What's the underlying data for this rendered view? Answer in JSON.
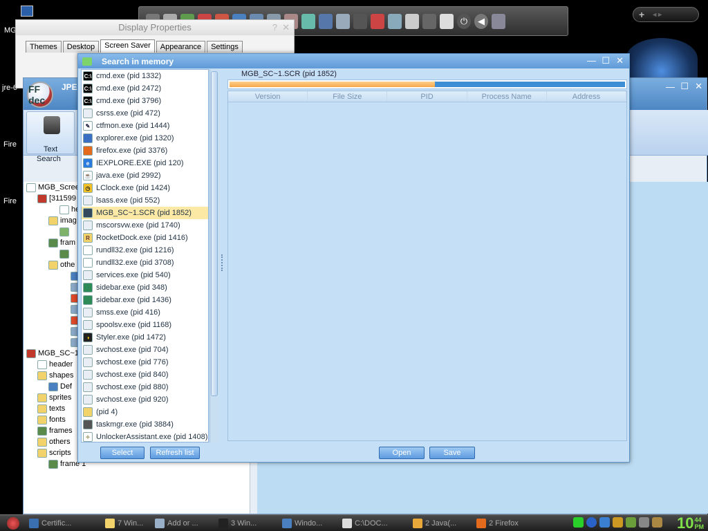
{
  "desktop": {
    "icons": [
      {
        "label": "MG"
      },
      {
        "label": "jre-6"
      },
      {
        "label": "Fire"
      },
      {
        "label": "Fire"
      }
    ],
    "gadget_plus": "+",
    "gadget_arrows": "◂ ▸"
  },
  "display_properties": {
    "title": "Display Properties",
    "tabs": [
      "Themes",
      "Desktop",
      "Screen Saver",
      "Appearance",
      "Settings"
    ],
    "active_tab": "Screen Saver",
    "help_label": "?",
    "close_label": "✕"
  },
  "ffdec": {
    "logo": "FF dec",
    "title_partial": "JPEX",
    "text_search_label": "Text",
    "search_label": "Search",
    "tree": [
      {
        "label": "MGB_Scree",
        "indent": 0,
        "icon": "#ffffff"
      },
      {
        "label": "[311599",
        "indent": 1,
        "icon": "#c0392b"
      },
      {
        "label": "head",
        "indent": 3,
        "icon": "#ffffff"
      },
      {
        "label": "imag",
        "indent": 2,
        "icon": "#f2d36b"
      },
      {
        "label": "",
        "indent": 3,
        "icon": "#7fb36a"
      },
      {
        "label": "fram",
        "indent": 2,
        "icon": "#5a8a4a"
      },
      {
        "label": "",
        "indent": 3,
        "icon": "#5a8a4a"
      },
      {
        "label": "othe",
        "indent": 2,
        "icon": "#f2d36b"
      },
      {
        "label": "",
        "indent": 4,
        "icon": "#4a7fc0"
      },
      {
        "label": "",
        "indent": 4,
        "icon": "#8aa9c8"
      },
      {
        "label": "",
        "indent": 4,
        "icon": "#e04a2a"
      },
      {
        "label": "",
        "indent": 4,
        "icon": "#8aa9c8"
      },
      {
        "label": "",
        "indent": 4,
        "icon": "#e04a2a"
      },
      {
        "label": "",
        "indent": 4,
        "icon": "#8aa9c8"
      },
      {
        "label": "",
        "indent": 4,
        "icon": "#8aa9c8"
      },
      {
        "label": "MGB_SC~1.",
        "indent": 0,
        "icon": "#c0392b"
      },
      {
        "label": "header",
        "indent": 1,
        "icon": "#ffffff"
      },
      {
        "label": "shapes",
        "indent": 1,
        "icon": "#f2d36b"
      },
      {
        "label": "Def",
        "indent": 2,
        "icon": "#4a7fc0"
      },
      {
        "label": "sprites",
        "indent": 1,
        "icon": "#f2d36b"
      },
      {
        "label": "texts",
        "indent": 1,
        "icon": "#f2d36b"
      },
      {
        "label": "fonts",
        "indent": 1,
        "icon": "#f2d36b"
      },
      {
        "label": "frames",
        "indent": 1,
        "icon": "#5a8a4a"
      },
      {
        "label": "others",
        "indent": 1,
        "icon": "#f2d36b"
      },
      {
        "label": "scripts",
        "indent": 1,
        "icon": "#f2d36b"
      },
      {
        "label": "frame 1",
        "indent": 2,
        "icon": "#5a8a4a"
      }
    ]
  },
  "search": {
    "title": "Search in memory",
    "selected_process": "MGB_SC~1.SCR (pid 1852)",
    "progress": 0.52,
    "columns": [
      "Version",
      "File Size",
      "PID",
      "Process Name",
      "Address"
    ],
    "select_label": "Select",
    "refresh_label": "Refresh list",
    "open_label": "Open",
    "save_label": "Save",
    "processes": [
      {
        "name": "cmd.exe (pid 1332)",
        "icon": "cmd"
      },
      {
        "name": "cmd.exe (pid 2472)",
        "icon": "cmd"
      },
      {
        "name": "cmd.exe (pid 3796)",
        "icon": "cmd"
      },
      {
        "name": "csrss.exe (pid 472)",
        "icon": "win"
      },
      {
        "name": "ctfmon.exe (pid 1444)",
        "icon": "pen"
      },
      {
        "name": "explorer.exe (pid 1320)",
        "icon": "explorer"
      },
      {
        "name": "firefox.exe (pid 3376)",
        "icon": "firefox"
      },
      {
        "name": "IEXPLORE.EXE (pid 120)",
        "icon": "ie"
      },
      {
        "name": "java.exe (pid 2992)",
        "icon": "java"
      },
      {
        "name": "LClock.exe (pid 1424)",
        "icon": "clock"
      },
      {
        "name": "lsass.exe (pid 552)",
        "icon": "win"
      },
      {
        "name": "MGB_SC~1.SCR (pid 1852)",
        "icon": "monitor"
      },
      {
        "name": "mscorsvw.exe (pid 1740)",
        "icon": "win"
      },
      {
        "name": "RocketDock.exe (pid 1416)",
        "icon": "rocket"
      },
      {
        "name": "rundll32.exe (pid 1216)",
        "icon": "file"
      },
      {
        "name": "rundll32.exe (pid 3708)",
        "icon": "file"
      },
      {
        "name": "services.exe (pid 540)",
        "icon": "win"
      },
      {
        "name": "sidebar.exe (pid 348)",
        "icon": "sidebar"
      },
      {
        "name": "sidebar.exe (pid 1436)",
        "icon": "sidebar"
      },
      {
        "name": "smss.exe (pid 416)",
        "icon": "win"
      },
      {
        "name": "spoolsv.exe (pid 1168)",
        "icon": "win"
      },
      {
        "name": "Styler.exe (pid 1472)",
        "icon": "styler"
      },
      {
        "name": "svchost.exe (pid 704)",
        "icon": "win"
      },
      {
        "name": "svchost.exe (pid 776)",
        "icon": "win"
      },
      {
        "name": "svchost.exe (pid 840)",
        "icon": "win"
      },
      {
        "name": "svchost.exe (pid 880)",
        "icon": "win"
      },
      {
        "name": "svchost.exe (pid 920)",
        "icon": "win"
      },
      {
        "name": " (pid 4)",
        "icon": "folder"
      },
      {
        "name": "taskmgr.exe (pid 3884)",
        "icon": "taskmgr"
      },
      {
        "name": "UnlockerAssistant.exe (pid 1408)",
        "icon": "wand"
      }
    ]
  },
  "taskbar": {
    "tasks": [
      {
        "label": "Certific...",
        "icon": "#3a6fb0"
      },
      {
        "label": "7 Win...",
        "icon": "#f2d36b"
      },
      {
        "label": "Add or ...",
        "icon": "#9ab0c8"
      },
      {
        "label": "3 Win...",
        "icon": "#222222"
      },
      {
        "label": "Windo...",
        "icon": "#4a7fc0"
      },
      {
        "label": "C:\\DOC...",
        "icon": "#dddddd"
      },
      {
        "label": "2 Java(...",
        "icon": "#e8a93a"
      },
      {
        "label": "2 Firefox",
        "icon": "#e46a1e"
      }
    ],
    "clock_hour": "10",
    "clock_min": "44",
    "clock_ampm": "PM"
  }
}
